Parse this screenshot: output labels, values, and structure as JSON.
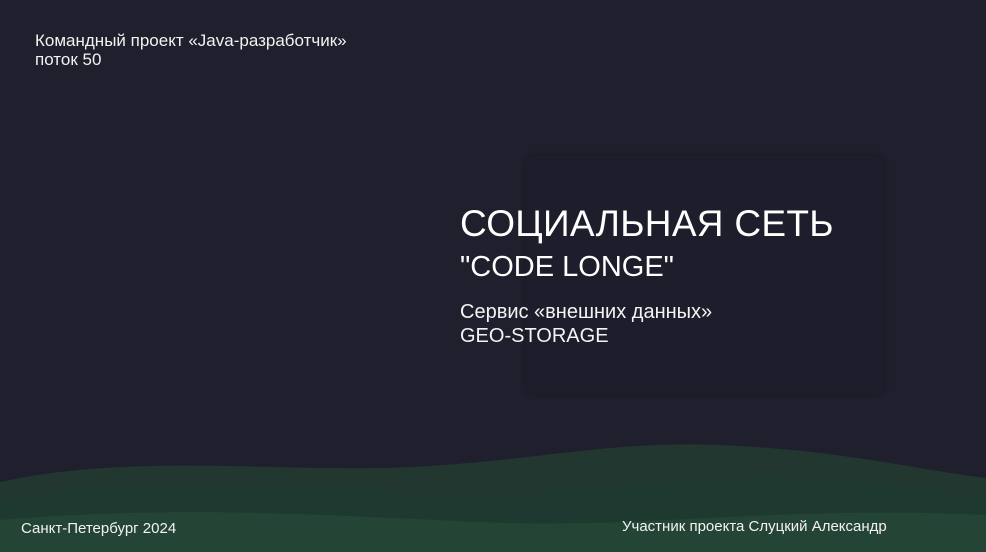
{
  "header": {
    "line1": "Командный проект «Java-разработчик»",
    "line2": "поток 50"
  },
  "title": {
    "main": "СОЦИАЛЬНАЯ СЕТЬ",
    "sub": "\"CODE LONGE\""
  },
  "service": {
    "line1": "Сервис «внешних данных»",
    "line2": "GEO-STORAGE"
  },
  "footer": {
    "city_year": "Санкт-Петербург 2024",
    "participant": "Участник проекта Слуцкий Александр"
  },
  "colors": {
    "background": "#1f1f2d",
    "wave_dark": "#1e3a32",
    "wave_light": "#2a4a3c"
  }
}
